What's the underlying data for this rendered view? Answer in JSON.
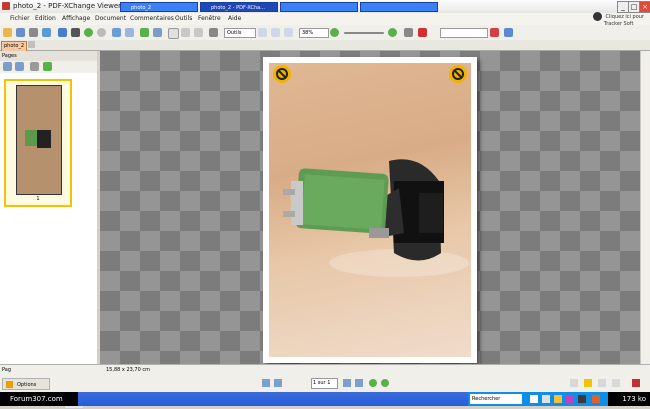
{
  "window": {
    "title": "photo_2 - PDF-XChange Viewer"
  },
  "menu": [
    "Fichier",
    "Edition",
    "Affichage",
    "Document",
    "Commentaires",
    "Outils",
    "Fenêtre",
    "Aide"
  ],
  "ad": {
    "line1": "Cliquez ici pour",
    "line2": "Tracker Soft"
  },
  "toolbar": {
    "zoom_value": "38%",
    "tool_label": "Outils"
  },
  "doc_tab": {
    "label": "photo_2"
  },
  "left_panel": {
    "header": "Pages",
    "thumbnail_number": "1"
  },
  "statusbar": {
    "page_size": "15,88 x 23,70 cm",
    "page_input": "1 sur 1",
    "options_label": "Options",
    "search_label": "Rechercher"
  },
  "taskbar": {
    "forum_label": "Forum307.com",
    "buttons": [
      "photo_2",
      "photo_2 - PDF-XCha...",
      "",
      ""
    ],
    "clock": "173 ko"
  }
}
